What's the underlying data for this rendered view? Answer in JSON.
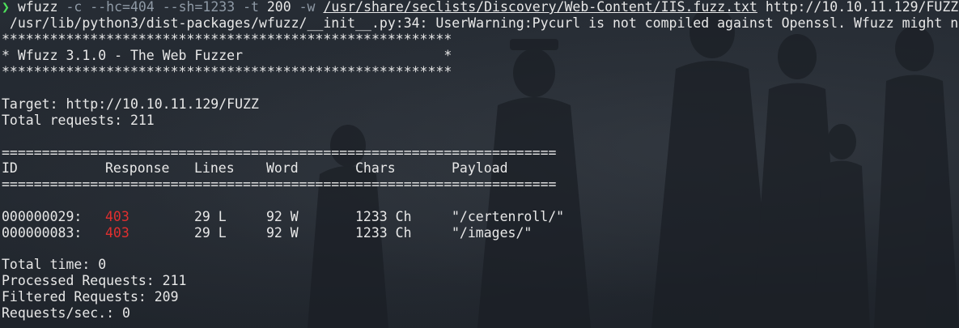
{
  "terminal": {
    "command": {
      "prompt_symbol": "❯",
      "program": "wfuzz",
      "flag_c": "-c",
      "flag_hc": "--hc=404",
      "flag_sh": "--sh=1233",
      "flag_t": "-t",
      "threads": "200",
      "flag_w": "-w",
      "wordlist": "/usr/share/seclists/Discovery/Web-Content/IIS.fuzz.txt",
      "url": "http://10.10.11.129/FUZZ"
    },
    "warning": " /usr/lib/python3/dist-packages/wfuzz/__init__.py:34: UserWarning:Pycurl is not compiled against Openssl. Wfuzz might n",
    "stars": "********************************************************",
    "banner": "* Wfuzz 3.1.0 - The Web Fuzzer                         *",
    "target": "Target: http://10.10.11.129/FUZZ",
    "total_requests": "Total requests: 211",
    "separator": "=====================================================================",
    "headers": {
      "id": "ID",
      "response": "Response",
      "lines": "Lines",
      "word": "Word",
      "chars": "Chars",
      "payload": "Payload"
    },
    "results": [
      {
        "id": "000000029:",
        "response": "403",
        "lines": "29 L",
        "word": "92 W",
        "chars": "1233 Ch",
        "payload": "\"/certenroll/\""
      },
      {
        "id": "000000083:",
        "response": "403",
        "lines": "29 L",
        "word": "92 W",
        "chars": "1233 Ch",
        "payload": "\"/images/\""
      }
    ],
    "summary": {
      "total_time": "Total time: 0",
      "processed": "Processed Requests: 211",
      "filtered": "Filtered Requests: 209",
      "rate": "Requests/sec.: 0"
    },
    "colors": {
      "prompt": "#4ee05b",
      "option": "#8f9aa6",
      "error_status": "#e02f2f",
      "background": "#222830"
    }
  }
}
